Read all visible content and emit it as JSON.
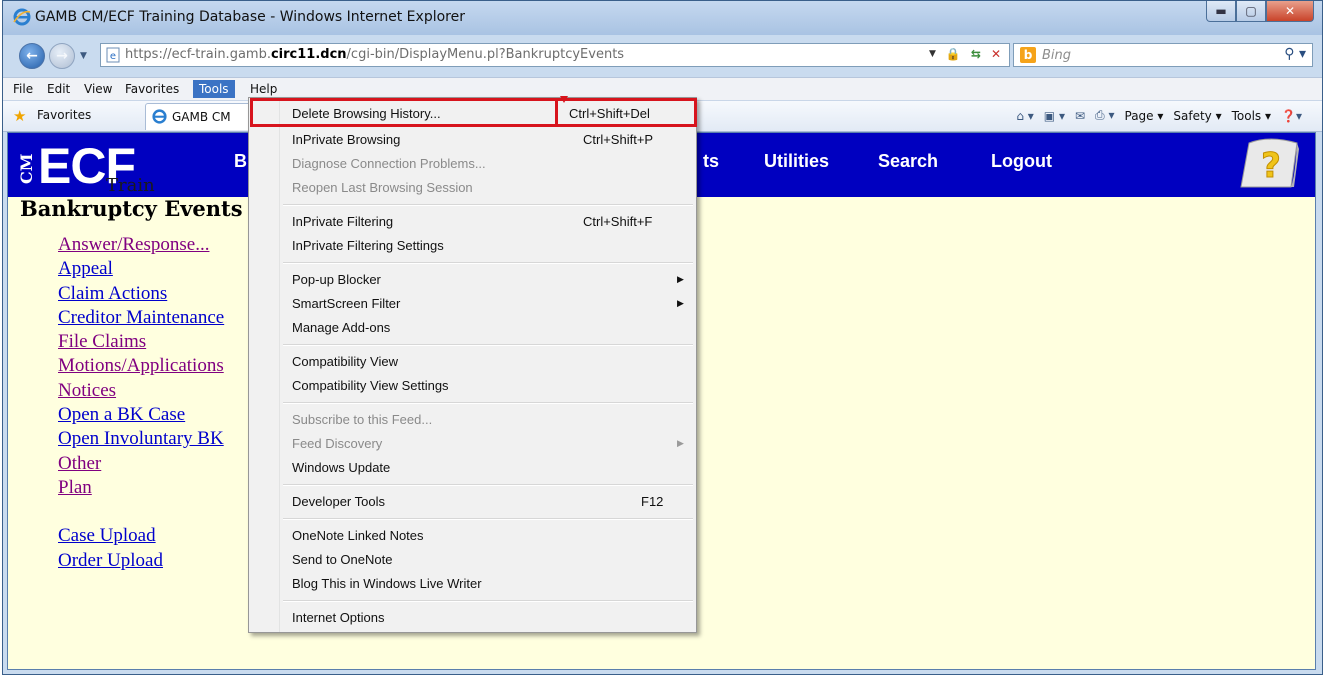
{
  "window": {
    "title": "GAMB CM/ECF Training Database - Windows Internet Explorer"
  },
  "address": {
    "url_prefix": "https://ecf-train.gamb.",
    "url_domain": "circ11.dcn",
    "url_suffix": "/cgi-bin/DisplayMenu.pl?BankruptcyEvents"
  },
  "search": {
    "placeholder": "Bing"
  },
  "menubar": {
    "items": [
      "File",
      "Edit",
      "View",
      "Favorites",
      "Tools",
      "Help"
    ],
    "active": "Tools"
  },
  "favorites_bar": {
    "favorites_label": "Favorites",
    "tab_title": "GAMB CM",
    "commands": [
      "Page ▾",
      "Safety ▾",
      "Tools ▾"
    ]
  },
  "ecf": {
    "logo_cm": "CM",
    "logo_main": "ECF",
    "logo_sub": "Train",
    "nav": [
      "B",
      "ts",
      "Utilities",
      "Search",
      "Logout"
    ],
    "page_title": "Bankruptcy Events",
    "links": [
      {
        "label": "Answer/Response...",
        "visited": true
      },
      {
        "label": "Appeal",
        "visited": false
      },
      {
        "label": "Claim Actions",
        "visited": false
      },
      {
        "label": "Creditor Maintenance",
        "visited": false
      },
      {
        "label": "File Claims",
        "visited": true
      },
      {
        "label": "Motions/Applications",
        "visited": true
      },
      {
        "label": "Notices",
        "visited": true
      },
      {
        "label": "Open a BK Case",
        "visited": false
      },
      {
        "label": "Open Involuntary BK",
        "visited": false
      },
      {
        "label": "Other",
        "visited": true
      },
      {
        "label": "Plan",
        "visited": true
      }
    ],
    "links2": [
      {
        "label": "Case Upload",
        "visited": false
      },
      {
        "label": "Order Upload",
        "visited": false
      }
    ]
  },
  "tools_menu": {
    "items": [
      {
        "label": "Delete Browsing History...",
        "shortcut": "Ctrl+Shift+Del",
        "disabled": false
      },
      {
        "label": "InPrivate Browsing",
        "shortcut": "Ctrl+Shift+P",
        "disabled": false
      },
      {
        "label": "Diagnose Connection Problems...",
        "shortcut": "",
        "disabled": true
      },
      {
        "label": "Reopen Last Browsing Session",
        "shortcut": "",
        "disabled": true
      },
      {
        "label": "InPrivate Filtering",
        "shortcut": "Ctrl+Shift+F",
        "disabled": false
      },
      {
        "label": "InPrivate Filtering Settings",
        "shortcut": "",
        "disabled": false
      },
      {
        "label": "Pop-up Blocker",
        "shortcut": "",
        "disabled": false,
        "submenu": true
      },
      {
        "label": "SmartScreen Filter",
        "shortcut": "",
        "disabled": false,
        "submenu": true
      },
      {
        "label": "Manage Add-ons",
        "shortcut": "",
        "disabled": false
      },
      {
        "label": "Compatibility View",
        "shortcut": "",
        "disabled": false
      },
      {
        "label": "Compatibility View Settings",
        "shortcut": "",
        "disabled": false
      },
      {
        "label": "Subscribe to this Feed...",
        "shortcut": "",
        "disabled": true
      },
      {
        "label": "Feed Discovery",
        "shortcut": "",
        "disabled": true,
        "submenu": true
      },
      {
        "label": "Windows Update",
        "shortcut": "",
        "disabled": false
      },
      {
        "label": "Developer Tools",
        "shortcut": "F12",
        "disabled": false
      },
      {
        "label": "OneNote Linked Notes",
        "shortcut": "",
        "disabled": false
      },
      {
        "label": "Send to OneNote",
        "shortcut": "",
        "disabled": false
      },
      {
        "label": "Blog This in Windows Live Writer",
        "shortcut": "",
        "disabled": false
      },
      {
        "label": "Internet Options",
        "shortcut": "",
        "disabled": false
      }
    ],
    "highlighted": "Delete Browsing History..."
  },
  "colors": {
    "ecf_bar": "#0000c0",
    "page_bg": "#ffffdf",
    "link_visited": "#800080",
    "link_new": "#0000cc",
    "highlight": "#d7141d",
    "menu_active": "#3b73c4"
  }
}
